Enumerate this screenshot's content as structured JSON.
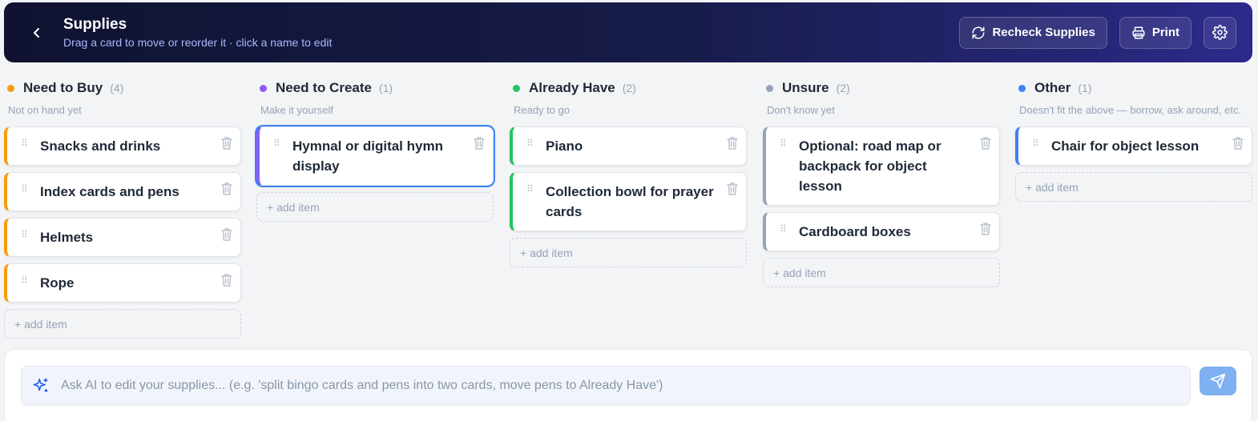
{
  "header": {
    "title": "Supplies",
    "subtitle": "Drag a card to move or reorder it · click a name to edit",
    "recheck_label": "Recheck Supplies",
    "print_label": "Print",
    "icons": [
      "chevron-left-icon",
      "refresh-icon",
      "printer-icon",
      "gear-icon"
    ]
  },
  "columns": [
    {
      "title": "Need to Buy",
      "count": "(4)",
      "color": "#f59e0b",
      "description": "Not on hand yet",
      "items": [
        "Snacks and drinks",
        "Index cards and pens",
        "Helmets",
        "Rope"
      ],
      "add_label": "+ add item"
    },
    {
      "title": "Need to Create",
      "count": "(1)",
      "color": "#8b5cf6",
      "description": "Make it yourself",
      "items": [
        "Hymnal or digital hymn display"
      ],
      "add_label": "+ add item"
    },
    {
      "title": "Already Have",
      "count": "(2)",
      "color": "#22c55e",
      "description": "Ready to go",
      "items": [
        "Piano",
        "Collection bowl for prayer cards"
      ],
      "add_label": "+ add item"
    },
    {
      "title": "Unsure",
      "count": "(2)",
      "color": "#94a3b8",
      "description": "Don't know yet",
      "items": [
        "Optional: road map or backpack for object lesson",
        "Cardboard boxes"
      ],
      "add_label": "+ add item"
    },
    {
      "title": "Other",
      "count": "(1)",
      "color": "#3b82f6",
      "description": "Doesn't fit the above — borrow, ask around, etc.",
      "items": [
        "Chair for object lesson"
      ],
      "add_label": "+ add item"
    }
  ],
  "ai": {
    "placeholder": "Ask AI to edit your supplies... (e.g. 'split bingo cards and pens into two cards, move pens to Already Have')",
    "value": "",
    "send_color": "#7fb0f2"
  }
}
